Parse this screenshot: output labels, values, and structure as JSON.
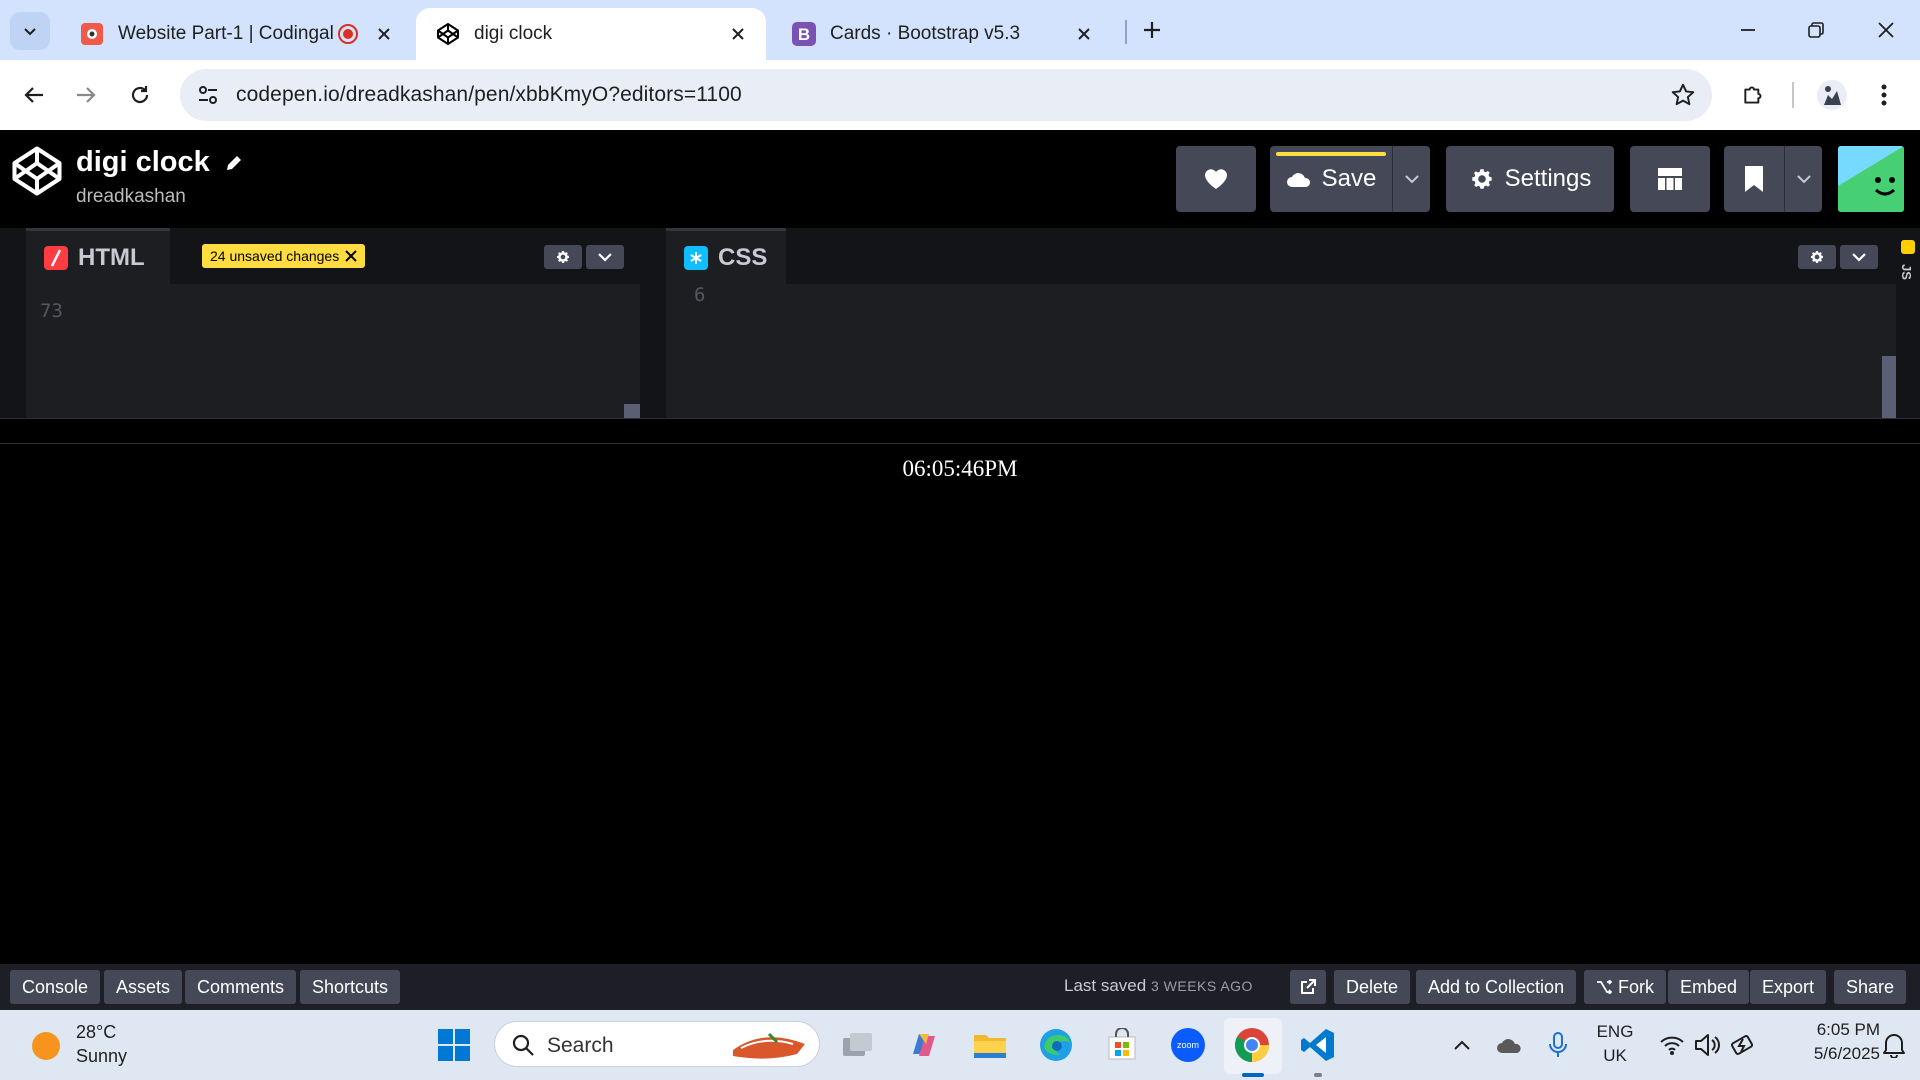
{
  "browser": {
    "tabs": [
      {
        "title": "Website Part-1 | Codingal",
        "favicon": "codingal-icon",
        "recording": true
      },
      {
        "title": "digi clock",
        "favicon": "codepen-icon",
        "active": true
      },
      {
        "title": "Cards · Bootstrap v5.3",
        "favicon": "bootstrap-icon"
      }
    ],
    "url": "codepen.io/dreadkashan/pen/xbbKmyO?editors=1100"
  },
  "codepen": {
    "pen_title": "digi clock",
    "author": "dreadkashan",
    "buttons": {
      "save": "Save",
      "settings": "Settings"
    },
    "editors": {
      "html": {
        "label": "HTML",
        "unsaved": "24 unsaved changes",
        "line_number": "73"
      },
      "css": {
        "label": "CSS",
        "line_number": "6"
      },
      "js": {
        "label": "JS"
      }
    },
    "preview": {
      "clock_text": "06:05:46PM"
    },
    "footer": {
      "left": [
        "Console",
        "Assets",
        "Comments",
        "Shortcuts"
      ],
      "last_saved_label": "Last saved",
      "last_saved_time": "3 WEEKS AGO",
      "right": [
        "Delete",
        "Add to Collection",
        "Fork",
        "Embed",
        "Export",
        "Share"
      ]
    }
  },
  "taskbar": {
    "weather": {
      "temp": "28°C",
      "desc": "Sunny"
    },
    "search_placeholder": "Search",
    "lang": {
      "line1": "ENG",
      "line2": "UK"
    },
    "clock": {
      "time": "6:05 PM",
      "date": "5/6/2025"
    }
  },
  "colors": {
    "codepen_yellow": "#ffdd40",
    "html_icon": "#ff3c41",
    "css_icon": "#0ebeff",
    "button_bg": "#444857"
  }
}
